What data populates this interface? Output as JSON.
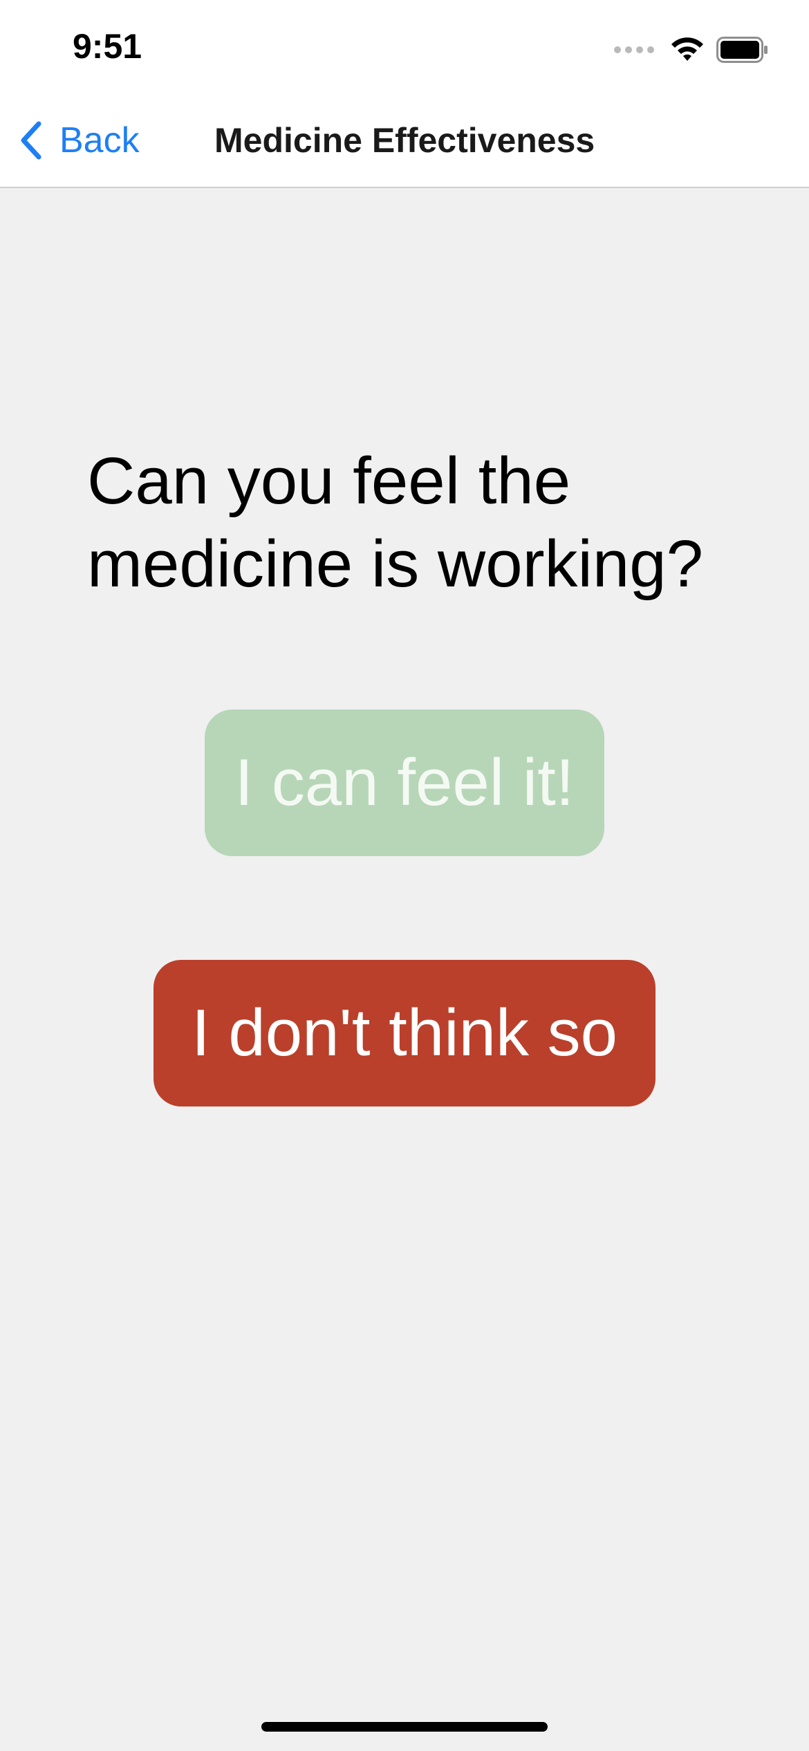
{
  "status_bar": {
    "time": "9:51"
  },
  "nav_bar": {
    "back_label": "Back",
    "title": "Medicine Effectiveness"
  },
  "content": {
    "question": "Can you feel the medicine is working?",
    "yes_button_label": "I can feel it!",
    "no_button_label": "I don't think so"
  },
  "colors": {
    "accent": "#1e7ff5",
    "yes_button": "#b7d6b8",
    "no_button": "#ba402b",
    "background": "#f0f0f0"
  }
}
